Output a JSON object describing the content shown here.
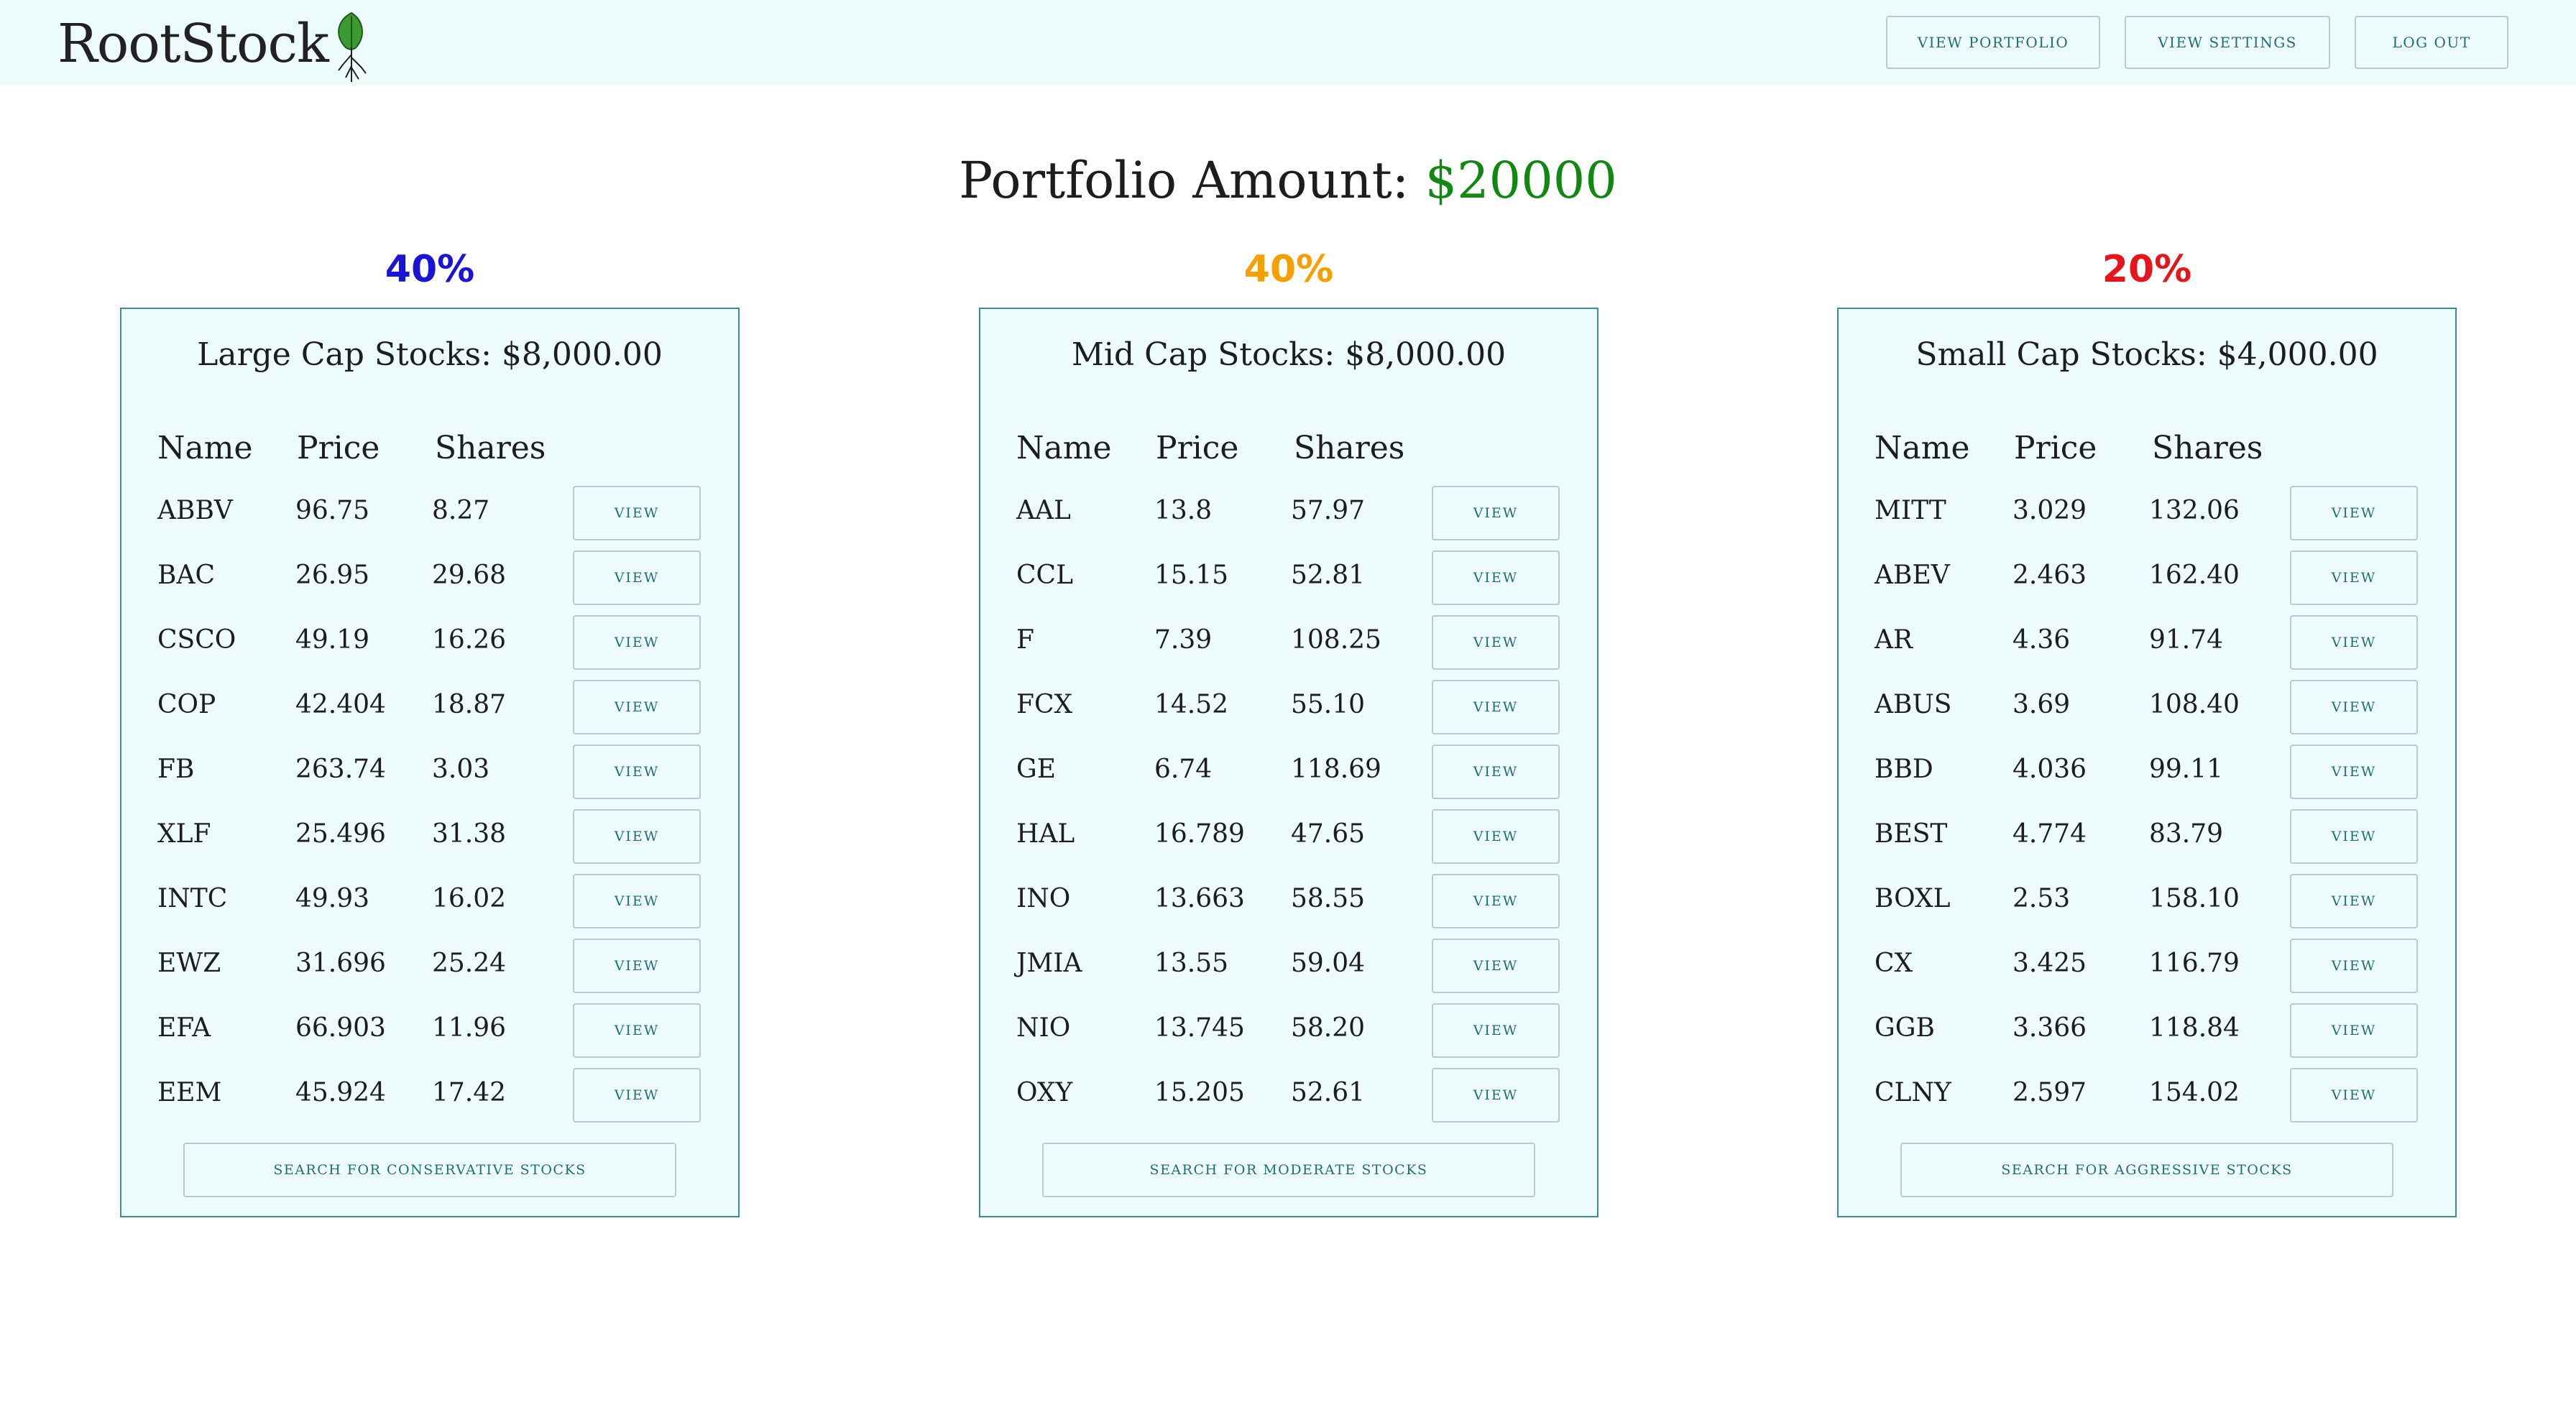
{
  "app": {
    "logo_text": "RootStock",
    "logo_icon": "leaf-with-roots-icon"
  },
  "nav": {
    "view_portfolio": "VIEW PORTFOLIO",
    "view_settings": "VIEW SETTINGS",
    "log_out": "LOG OUT"
  },
  "portfolio": {
    "label": "Portfolio Amount:",
    "amount": "$20000",
    "amount_color": "#118811"
  },
  "table_headers": {
    "name": "Name",
    "price": "Price",
    "shares": "Shares"
  },
  "view_label": "VIEW",
  "categories": [
    {
      "percent": "40%",
      "percent_color": "#1a14d6",
      "title": "Large Cap Stocks: $8,000.00",
      "search_label": "SEARCH FOR CONSERVATIVE STOCKS",
      "stocks": [
        {
          "name": "ABBV",
          "price": "96.75",
          "shares": "8.27"
        },
        {
          "name": "BAC",
          "price": "26.95",
          "shares": "29.68"
        },
        {
          "name": "CSCO",
          "price": "49.19",
          "shares": "16.26"
        },
        {
          "name": "COP",
          "price": "42.404",
          "shares": "18.87"
        },
        {
          "name": "FB",
          "price": "263.74",
          "shares": "3.03"
        },
        {
          "name": "XLF",
          "price": "25.496",
          "shares": "31.38"
        },
        {
          "name": "INTC",
          "price": "49.93",
          "shares": "16.02"
        },
        {
          "name": "EWZ",
          "price": "31.696",
          "shares": "25.24"
        },
        {
          "name": "EFA",
          "price": "66.903",
          "shares": "11.96"
        },
        {
          "name": "EEM",
          "price": "45.924",
          "shares": "17.42"
        }
      ]
    },
    {
      "percent": "40%",
      "percent_color": "#f5a000",
      "title": "Mid Cap Stocks: $8,000.00",
      "search_label": "SEARCH FOR MODERATE STOCKS",
      "stocks": [
        {
          "name": "AAL",
          "price": "13.8",
          "shares": "57.97"
        },
        {
          "name": "CCL",
          "price": "15.15",
          "shares": "52.81"
        },
        {
          "name": "F",
          "price": "7.39",
          "shares": "108.25"
        },
        {
          "name": "FCX",
          "price": "14.52",
          "shares": "55.10"
        },
        {
          "name": "GE",
          "price": "6.74",
          "shares": "118.69"
        },
        {
          "name": "HAL",
          "price": "16.789",
          "shares": "47.65"
        },
        {
          "name": "INO",
          "price": "13.663",
          "shares": "58.55"
        },
        {
          "name": "JMIA",
          "price": "13.55",
          "shares": "59.04"
        },
        {
          "name": "NIO",
          "price": "13.745",
          "shares": "58.20"
        },
        {
          "name": "OXY",
          "price": "15.205",
          "shares": "52.61"
        }
      ]
    },
    {
      "percent": "20%",
      "percent_color": "#e8141c",
      "title": "Small Cap Stocks: $4,000.00",
      "search_label": "SEARCH FOR AGGRESSIVE STOCKS",
      "stocks": [
        {
          "name": "MITT",
          "price": "3.029",
          "shares": "132.06"
        },
        {
          "name": "ABEV",
          "price": "2.463",
          "shares": "162.40"
        },
        {
          "name": "AR",
          "price": "4.36",
          "shares": "91.74"
        },
        {
          "name": "ABUS",
          "price": "3.69",
          "shares": "108.40"
        },
        {
          "name": "BBD",
          "price": "4.036",
          "shares": "99.11"
        },
        {
          "name": "BEST",
          "price": "4.774",
          "shares": "83.79"
        },
        {
          "name": "BOXL",
          "price": "2.53",
          "shares": "158.10"
        },
        {
          "name": "CX",
          "price": "3.425",
          "shares": "116.79"
        },
        {
          "name": "GGB",
          "price": "3.366",
          "shares": "118.84"
        },
        {
          "name": "CLNY",
          "price": "2.597",
          "shares": "154.02"
        }
      ]
    }
  ]
}
